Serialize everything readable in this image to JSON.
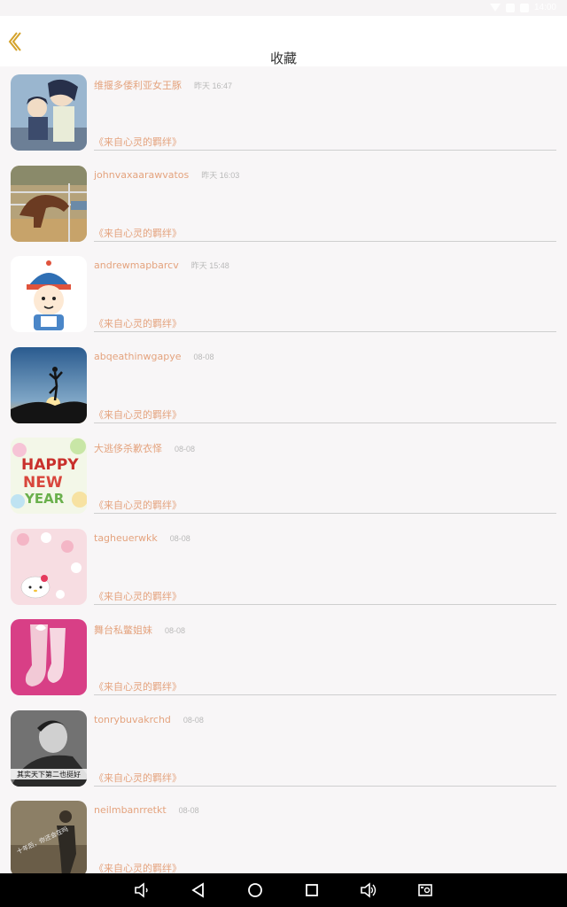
{
  "status_bar": {
    "time": "14:00"
  },
  "header": {
    "title": "收藏",
    "back_icon": "chevron-left-icon",
    "accent": "#e4a37e"
  },
  "items": [
    {
      "name": "维揠多倭利亚女王豚",
      "time": "昨天 16:47",
      "source": "《来自心灵的羁绊》",
      "image": "anime-couple-image"
    },
    {
      "name": "johnvaxaarawvatos",
      "time": "昨天 16:03",
      "source": "《来自心灵的羁绊》",
      "image": "horse-fence-image"
    },
    {
      "name": "andrewmapbarcv",
      "time": "昨天 15:48",
      "source": "《来自心灵的羁绊》",
      "image": "cartoon-boy-image"
    },
    {
      "name": "abqeathinwgapye",
      "time": "08-08",
      "source": "《来自心灵的羁绊》",
      "image": "sunset-silhouette-image"
    },
    {
      "name": "大逃侈杀歉衣怿",
      "time": "08-08",
      "source": "《来自心灵的羁绊》",
      "image": "happy-new-year-image"
    },
    {
      "name": "tagheuerwkk",
      "time": "08-08",
      "source": "《来自心灵的羁绊》",
      "image": "hello-kitty-image"
    },
    {
      "name": "舞台私鳖姐妹",
      "time": "08-08",
      "source": "《来自心灵的羁绊》",
      "image": "pink-socks-image"
    },
    {
      "name": "tonrybuvakrchd",
      "time": "08-08",
      "source": "《来自心灵的羁绊》",
      "image": "bw-portrait-image",
      "caption": "其实天下第二也挺好"
    },
    {
      "name": "neilmbanrretkt",
      "time": "08-08",
      "source": "《来自心灵的羁绊》",
      "image": "man-outdoors-image",
      "caption": "十年后，你还会在吗"
    }
  ],
  "navbar": {
    "icons": [
      "volume-down-icon",
      "back-icon",
      "home-icon",
      "recents-icon",
      "volume-up-icon",
      "screenshot-icon"
    ]
  }
}
